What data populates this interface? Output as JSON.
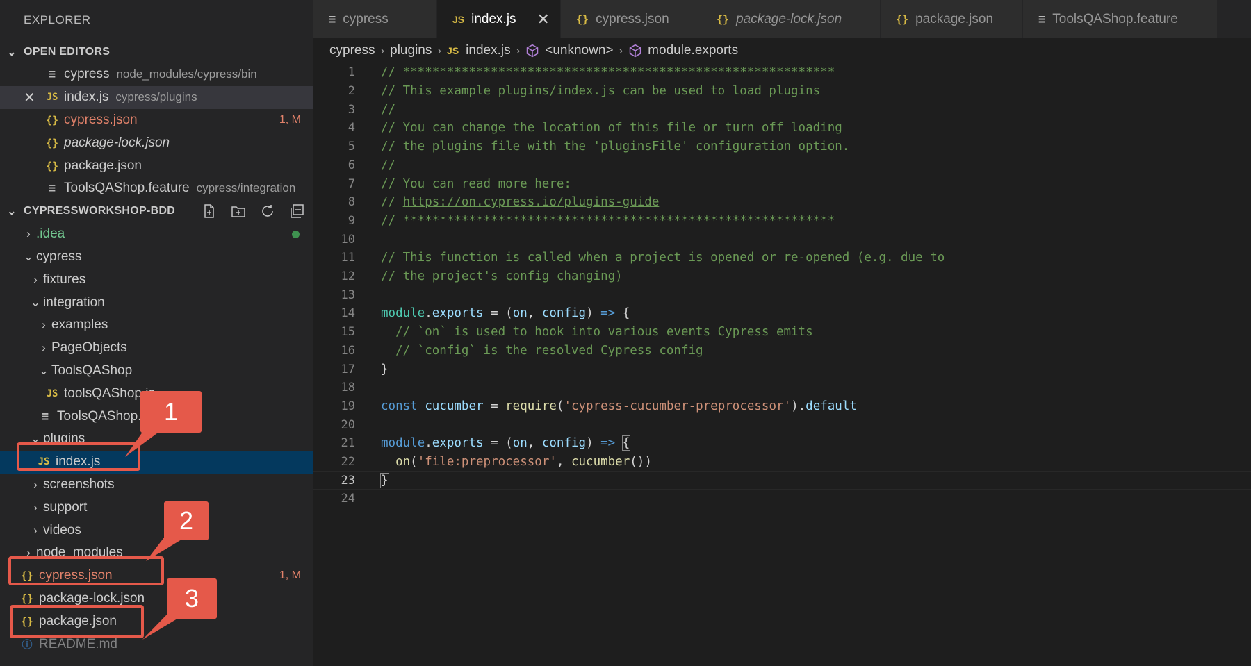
{
  "sidebar": {
    "title": "EXPLORER",
    "open_editors": {
      "header": "OPEN EDITORS",
      "items": [
        {
          "label": "cypress",
          "desc": "node_modules/cypress/bin",
          "icon": "file-lines-icon"
        },
        {
          "label": "index.js",
          "desc": "cypress/plugins",
          "icon": "js-icon"
        },
        {
          "label": "cypress.json",
          "badge": "1, M",
          "icon": "json-braces-icon"
        },
        {
          "label": "package-lock.json",
          "icon": "json-braces-icon"
        },
        {
          "label": "package.json",
          "icon": "json-braces-icon"
        },
        {
          "label": "ToolsQAShop.feature",
          "desc": "cypress/integration",
          "icon": "file-lines-icon"
        }
      ]
    },
    "workspace": {
      "header": "CYPRESSWORKSHOP-BDD",
      "tree": [
        {
          "label": ".idea"
        },
        {
          "label": "cypress"
        },
        {
          "label": "fixtures"
        },
        {
          "label": "integration"
        },
        {
          "label": "examples"
        },
        {
          "label": "PageObjects"
        },
        {
          "label": "ToolsQAShop"
        },
        {
          "label": "toolsQAShop.js"
        },
        {
          "label": "ToolsQAShop.feature"
        },
        {
          "label": "plugins"
        },
        {
          "label": "index.js"
        },
        {
          "label": "screenshots"
        },
        {
          "label": "support"
        },
        {
          "label": "videos"
        },
        {
          "label": "node_modules"
        },
        {
          "label": "cypress.json",
          "badge": "1, M"
        },
        {
          "label": "package-lock.json"
        },
        {
          "label": "package.json"
        },
        {
          "label": "README.md"
        }
      ]
    }
  },
  "tabs": [
    {
      "label": "cypress",
      "icon": "file-lines-icon"
    },
    {
      "label": "index.js",
      "icon": "js-icon",
      "close": "✕"
    },
    {
      "label": "cypress.json",
      "icon": "json-braces-icon"
    },
    {
      "label": "package-lock.json",
      "icon": "json-braces-icon"
    },
    {
      "label": "package.json",
      "icon": "json-braces-icon"
    },
    {
      "label": "ToolsQAShop.feature",
      "icon": "file-lines-icon"
    }
  ],
  "breadcrumb": [
    "cypress",
    "plugins",
    "index.js",
    "<unknown>",
    "module.exports"
  ],
  "editor": {
    "line_numbers": [
      "1",
      "2",
      "3",
      "4",
      "5",
      "6",
      "7",
      "8",
      "9",
      "10",
      "11",
      "12",
      "13",
      "14",
      "15",
      "16",
      "17",
      "18",
      "19",
      "20",
      "21",
      "22",
      "23",
      "24"
    ],
    "current_line": 23,
    "code": {
      "l1": "// ***********************************************************",
      "l2": "// This example plugins/index.js can be used to load plugins",
      "l3": "//",
      "l4": "// You can change the location of this file or turn off loading",
      "l5": "// the plugins file with the 'pluginsFile' configuration option.",
      "l6": "//",
      "l7": "// You can read more here:",
      "l8_prefix": "// ",
      "l8_link": "https://on.cypress.io/plugins-guide",
      "l9": "// ***********************************************************",
      "l11": "// This function is called when a project is opened or re-opened (e.g. due to",
      "l12": "// the project's config changing)",
      "l15": "  // `on` is used to hook into various events Cypress emits",
      "l16": "  // `config` is the resolved Cypress config",
      "tok_module": "module",
      "tok_dot": ".",
      "tok_exports": "exports",
      "tok_assign": " = (",
      "tok_on": "on",
      "tok_comma": ", ",
      "tok_config": "config",
      "tok_close_paren": ") ",
      "tok_arrow": "=>",
      "tok_space": " ",
      "tok_open_brace": "{",
      "tok_close_brace": "}",
      "tok_const": "const",
      "tok_cucumber": "cucumber",
      "tok_eq": " = ",
      "tok_require": "require",
      "tok_lparen": "(",
      "tok_req_str": "'cypress-cucumber-preprocessor'",
      "tok_rparen_dot": ").",
      "tok_default": "default",
      "tok_indent_on": "  on",
      "tok_file_str": "'file:preprocessor'",
      "tok_cucumber_call": "cucumber",
      "tok_end_call": "())"
    }
  },
  "annotations": [
    "1",
    "2",
    "3"
  ],
  "colors": {
    "annotation": "#e5594a",
    "selection": "#04395e",
    "modified": "#e2826a",
    "json_icon": "#d7ba45"
  }
}
